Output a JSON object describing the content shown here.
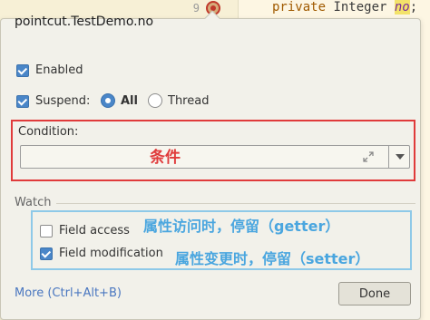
{
  "editor": {
    "line_number": "9",
    "code": {
      "keyword": "private",
      "type": " Integer ",
      "field": "no",
      "end": ";"
    }
  },
  "popup": {
    "title": "pointcut.TestDemo.no",
    "enabled": {
      "label": "Enabled",
      "checked": true
    },
    "suspend": {
      "label": "Suspend:",
      "checked": true
    },
    "suspend_policy": {
      "options": [
        {
          "label": "All",
          "selected": true
        },
        {
          "label": "Thread",
          "selected": false
        }
      ]
    },
    "condition": {
      "label": "Condition:",
      "value": "",
      "annotation": "条件",
      "expand_icon": "expand-icon",
      "dropdown_icon": "chevron-down-icon"
    },
    "watch": {
      "label": "Watch",
      "field_access": {
        "label": "Field access",
        "checked": false,
        "annotation": "属性访问时，停留（getter）"
      },
      "field_modification": {
        "label": "Field modification",
        "checked": true,
        "annotation": "属性变更时，停留（setter）"
      }
    },
    "more_link": "More (Ctrl+Alt+B)",
    "done_label": "Done"
  },
  "colors": {
    "annotation_red": "#e03b3b",
    "annotation_blue": "#4aa6df",
    "checkbox_accent": "#4a86c8"
  }
}
